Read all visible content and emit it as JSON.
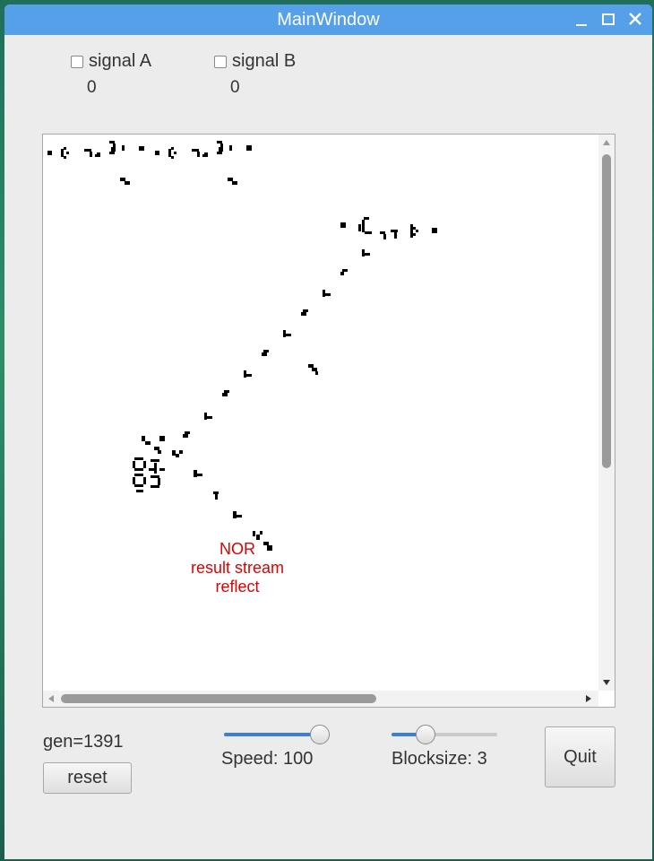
{
  "window": {
    "title": "MainWindow",
    "controls": [
      "minimize-icon",
      "maximize-icon",
      "close-icon"
    ]
  },
  "signals": [
    {
      "label": "signal A",
      "checked": false,
      "value": "0"
    },
    {
      "label": "signal B",
      "checked": false,
      "value": "0"
    }
  ],
  "canvas": {
    "annotation": [
      "NOR",
      "result stream",
      "reflect"
    ],
    "annotation_color": "#e00000"
  },
  "status": {
    "generation": "gen=1391"
  },
  "controls": {
    "reset_label": "reset",
    "speed_label": "Speed: 100",
    "speed_value": 1.0,
    "blocksize_label": "Blocksize: 3",
    "blocksize_value": 0.28,
    "quit_label": "Quit"
  },
  "colors": {
    "titlebar": "#56a0ea",
    "accent": "#3c7fd6"
  }
}
